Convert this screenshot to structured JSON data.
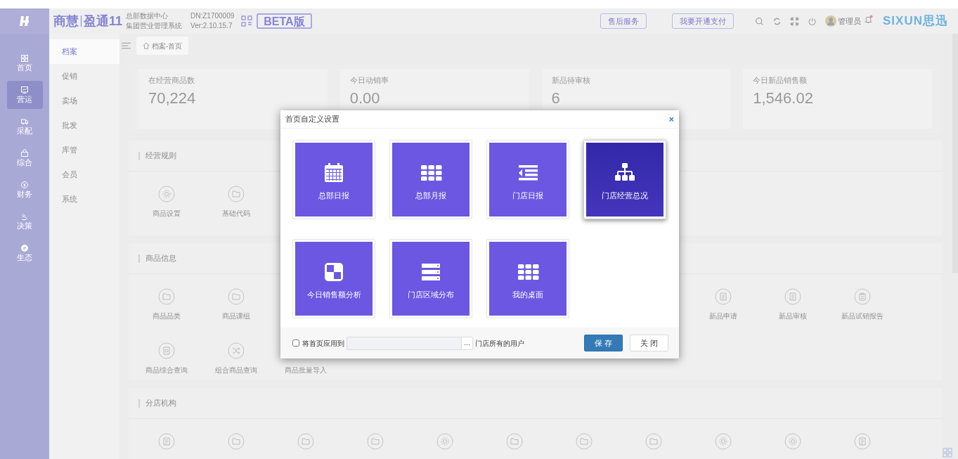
{
  "header": {
    "brand": "商慧",
    "brand_2": "盈通11",
    "subtitle_1": "总部数据中心",
    "subtitle_2": "集团营业管理系统",
    "dn": "DN:Z1700009",
    "version": "Ver:2.10.15.7",
    "badge": "BETA版",
    "buttons": [
      "售后服务",
      "我要开通支付"
    ],
    "user": "管理员",
    "logo": "SIXUN思迅"
  },
  "rail": [
    {
      "label": "首页",
      "kind": "grid",
      "selected": false
    },
    {
      "label": "营运",
      "kind": "chart",
      "selected": true
    },
    {
      "label": "采配",
      "kind": "truck",
      "selected": false
    },
    {
      "label": "综合",
      "kind": "bag",
      "selected": false
    },
    {
      "label": "财务",
      "kind": "coin",
      "selected": false
    },
    {
      "label": "决策",
      "kind": "gavel",
      "selected": false
    },
    {
      "label": "生态",
      "kind": "compass",
      "selected": false
    }
  ],
  "menu": [
    {
      "label": "档案",
      "selected": true
    },
    {
      "label": "促销",
      "selected": false
    },
    {
      "label": "卖场",
      "selected": false
    },
    {
      "label": "批发",
      "selected": false
    },
    {
      "label": "库管",
      "selected": false
    },
    {
      "label": "会员",
      "selected": false
    },
    {
      "label": "系统",
      "selected": false
    }
  ],
  "breadcrumb": "档案-首页",
  "stats": [
    {
      "label": "在经营商品数",
      "value": "70,224"
    },
    {
      "label": "今日动销率",
      "value": "0.00"
    },
    {
      "label": "新品待审核",
      "value": "6"
    },
    {
      "label": "今日新品销售额",
      "value": "1,546.02"
    }
  ],
  "sections": [
    {
      "title": "经营规则",
      "rows": [
        {
          "left": [
            {
              "kind": "gear",
              "label": "商品设置"
            },
            {
              "kind": "folder",
              "label": "基础代码"
            }
          ],
          "right": []
        }
      ]
    },
    {
      "title": "商品信息",
      "rows": [
        {
          "left": [
            {
              "kind": "folder",
              "label": "商品品类"
            },
            {
              "kind": "folder",
              "label": "商品课组"
            }
          ],
          "right": [
            {
              "kind": "doc",
              "label": "新品申请"
            },
            {
              "kind": "doc",
              "label": "新品审核"
            },
            {
              "kind": "clipboard",
              "label": "新品试销报告"
            }
          ]
        },
        {
          "left": [
            {
              "kind": "search",
              "label": "商品综合查询"
            },
            {
              "kind": "shuffle",
              "label": "组合商品查询"
            },
            {
              "kind": "none",
              "label": "商品批量导入"
            }
          ],
          "right": []
        }
      ]
    },
    {
      "title": "分店机构",
      "rows": [
        {
          "left": [
            {
              "kind": "doc"
            },
            {
              "kind": "folder"
            },
            {
              "kind": "folder"
            },
            {
              "kind": "folder"
            },
            {
              "kind": "gear"
            },
            {
              "kind": "folder"
            },
            {
              "kind": "folder"
            },
            {
              "kind": "folder"
            },
            {
              "kind": "gear"
            },
            {
              "kind": "gear"
            },
            {
              "kind": "doc"
            }
          ],
          "right": []
        }
      ]
    }
  ],
  "dialog": {
    "title": "首页自定义设置",
    "close": "×",
    "tiles": [
      {
        "label": "总部日报",
        "kind": "calendar",
        "selected": false
      },
      {
        "label": "总部月报",
        "kind": "grid",
        "selected": false
      },
      {
        "label": "门店日报",
        "kind": "indent",
        "selected": false
      },
      {
        "label": "门店经营总况",
        "kind": "org",
        "selected": true
      },
      {
        "label": "今日销售额分析",
        "kind": "pie",
        "selected": false
      },
      {
        "label": "门店区域分布",
        "kind": "server",
        "selected": false
      },
      {
        "label": "我的桌面",
        "kind": "grid",
        "selected": false
      }
    ],
    "apply": {
      "checked": false,
      "label": "将首页应用到",
      "browse": "...",
      "suffix": "门店所有的用户"
    },
    "buttons": [
      {
        "label": "保 存",
        "kind": "primary"
      },
      {
        "label": "关 闭",
        "kind": "default"
      }
    ]
  }
}
